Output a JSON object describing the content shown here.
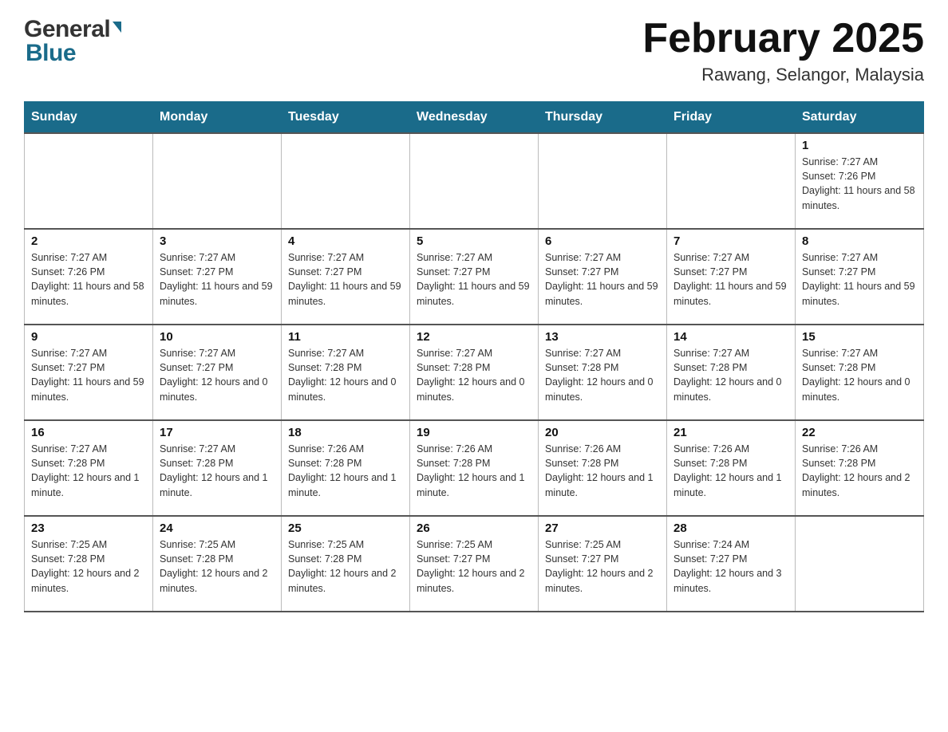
{
  "logo": {
    "general": "General",
    "blue": "Blue"
  },
  "title": "February 2025",
  "subtitle": "Rawang, Selangor, Malaysia",
  "weekdays": [
    "Sunday",
    "Monday",
    "Tuesday",
    "Wednesday",
    "Thursday",
    "Friday",
    "Saturday"
  ],
  "weeks": [
    [
      {
        "day": "",
        "sunrise": "",
        "sunset": "",
        "daylight": ""
      },
      {
        "day": "",
        "sunrise": "",
        "sunset": "",
        "daylight": ""
      },
      {
        "day": "",
        "sunrise": "",
        "sunset": "",
        "daylight": ""
      },
      {
        "day": "",
        "sunrise": "",
        "sunset": "",
        "daylight": ""
      },
      {
        "day": "",
        "sunrise": "",
        "sunset": "",
        "daylight": ""
      },
      {
        "day": "",
        "sunrise": "",
        "sunset": "",
        "daylight": ""
      },
      {
        "day": "1",
        "sunrise": "Sunrise: 7:27 AM",
        "sunset": "Sunset: 7:26 PM",
        "daylight": "Daylight: 11 hours and 58 minutes."
      }
    ],
    [
      {
        "day": "2",
        "sunrise": "Sunrise: 7:27 AM",
        "sunset": "Sunset: 7:26 PM",
        "daylight": "Daylight: 11 hours and 58 minutes."
      },
      {
        "day": "3",
        "sunrise": "Sunrise: 7:27 AM",
        "sunset": "Sunset: 7:27 PM",
        "daylight": "Daylight: 11 hours and 59 minutes."
      },
      {
        "day": "4",
        "sunrise": "Sunrise: 7:27 AM",
        "sunset": "Sunset: 7:27 PM",
        "daylight": "Daylight: 11 hours and 59 minutes."
      },
      {
        "day": "5",
        "sunrise": "Sunrise: 7:27 AM",
        "sunset": "Sunset: 7:27 PM",
        "daylight": "Daylight: 11 hours and 59 minutes."
      },
      {
        "day": "6",
        "sunrise": "Sunrise: 7:27 AM",
        "sunset": "Sunset: 7:27 PM",
        "daylight": "Daylight: 11 hours and 59 minutes."
      },
      {
        "day": "7",
        "sunrise": "Sunrise: 7:27 AM",
        "sunset": "Sunset: 7:27 PM",
        "daylight": "Daylight: 11 hours and 59 minutes."
      },
      {
        "day": "8",
        "sunrise": "Sunrise: 7:27 AM",
        "sunset": "Sunset: 7:27 PM",
        "daylight": "Daylight: 11 hours and 59 minutes."
      }
    ],
    [
      {
        "day": "9",
        "sunrise": "Sunrise: 7:27 AM",
        "sunset": "Sunset: 7:27 PM",
        "daylight": "Daylight: 11 hours and 59 minutes."
      },
      {
        "day": "10",
        "sunrise": "Sunrise: 7:27 AM",
        "sunset": "Sunset: 7:27 PM",
        "daylight": "Daylight: 12 hours and 0 minutes."
      },
      {
        "day": "11",
        "sunrise": "Sunrise: 7:27 AM",
        "sunset": "Sunset: 7:28 PM",
        "daylight": "Daylight: 12 hours and 0 minutes."
      },
      {
        "day": "12",
        "sunrise": "Sunrise: 7:27 AM",
        "sunset": "Sunset: 7:28 PM",
        "daylight": "Daylight: 12 hours and 0 minutes."
      },
      {
        "day": "13",
        "sunrise": "Sunrise: 7:27 AM",
        "sunset": "Sunset: 7:28 PM",
        "daylight": "Daylight: 12 hours and 0 minutes."
      },
      {
        "day": "14",
        "sunrise": "Sunrise: 7:27 AM",
        "sunset": "Sunset: 7:28 PM",
        "daylight": "Daylight: 12 hours and 0 minutes."
      },
      {
        "day": "15",
        "sunrise": "Sunrise: 7:27 AM",
        "sunset": "Sunset: 7:28 PM",
        "daylight": "Daylight: 12 hours and 0 minutes."
      }
    ],
    [
      {
        "day": "16",
        "sunrise": "Sunrise: 7:27 AM",
        "sunset": "Sunset: 7:28 PM",
        "daylight": "Daylight: 12 hours and 1 minute."
      },
      {
        "day": "17",
        "sunrise": "Sunrise: 7:27 AM",
        "sunset": "Sunset: 7:28 PM",
        "daylight": "Daylight: 12 hours and 1 minute."
      },
      {
        "day": "18",
        "sunrise": "Sunrise: 7:26 AM",
        "sunset": "Sunset: 7:28 PM",
        "daylight": "Daylight: 12 hours and 1 minute."
      },
      {
        "day": "19",
        "sunrise": "Sunrise: 7:26 AM",
        "sunset": "Sunset: 7:28 PM",
        "daylight": "Daylight: 12 hours and 1 minute."
      },
      {
        "day": "20",
        "sunrise": "Sunrise: 7:26 AM",
        "sunset": "Sunset: 7:28 PM",
        "daylight": "Daylight: 12 hours and 1 minute."
      },
      {
        "day": "21",
        "sunrise": "Sunrise: 7:26 AM",
        "sunset": "Sunset: 7:28 PM",
        "daylight": "Daylight: 12 hours and 1 minute."
      },
      {
        "day": "22",
        "sunrise": "Sunrise: 7:26 AM",
        "sunset": "Sunset: 7:28 PM",
        "daylight": "Daylight: 12 hours and 2 minutes."
      }
    ],
    [
      {
        "day": "23",
        "sunrise": "Sunrise: 7:25 AM",
        "sunset": "Sunset: 7:28 PM",
        "daylight": "Daylight: 12 hours and 2 minutes."
      },
      {
        "day": "24",
        "sunrise": "Sunrise: 7:25 AM",
        "sunset": "Sunset: 7:28 PM",
        "daylight": "Daylight: 12 hours and 2 minutes."
      },
      {
        "day": "25",
        "sunrise": "Sunrise: 7:25 AM",
        "sunset": "Sunset: 7:28 PM",
        "daylight": "Daylight: 12 hours and 2 minutes."
      },
      {
        "day": "26",
        "sunrise": "Sunrise: 7:25 AM",
        "sunset": "Sunset: 7:27 PM",
        "daylight": "Daylight: 12 hours and 2 minutes."
      },
      {
        "day": "27",
        "sunrise": "Sunrise: 7:25 AM",
        "sunset": "Sunset: 7:27 PM",
        "daylight": "Daylight: 12 hours and 2 minutes."
      },
      {
        "day": "28",
        "sunrise": "Sunrise: 7:24 AM",
        "sunset": "Sunset: 7:27 PM",
        "daylight": "Daylight: 12 hours and 3 minutes."
      },
      {
        "day": "",
        "sunrise": "",
        "sunset": "",
        "daylight": ""
      }
    ]
  ]
}
